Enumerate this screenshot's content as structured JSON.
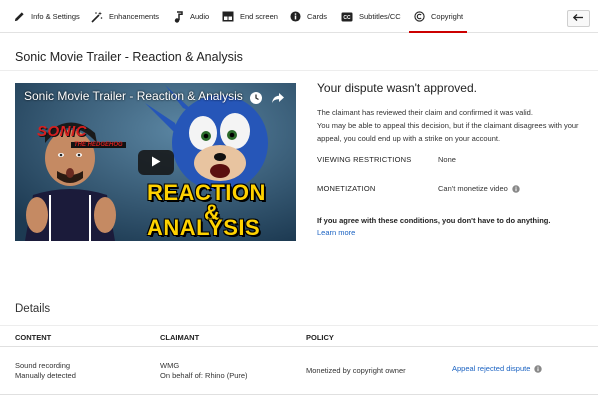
{
  "tabs": [
    {
      "label": "Info & Settings",
      "icon": "pencil-icon"
    },
    {
      "label": "Enhancements",
      "icon": "magic-wand-icon"
    },
    {
      "label": "Audio",
      "icon": "music-note-icon"
    },
    {
      "label": "End screen",
      "icon": "end-screen-icon"
    },
    {
      "label": "Cards",
      "icon": "info-circle-icon"
    },
    {
      "label": "Subtitles/CC",
      "icon": "cc-icon"
    },
    {
      "label": "Copyright",
      "icon": "copyright-icon",
      "active": true
    }
  ],
  "colors": {
    "accent": "#cc0000",
    "link": "#1a62c2"
  },
  "video": {
    "title": "Sonic Movie Trailer - Reaction & Analysis",
    "thumbnail": {
      "overlay_title": "Sonic Movie Trailer - Reaction & Analysis",
      "text_sonic": "SONIC",
      "text_hedgehog": "THE HEDGEHOG",
      "text_line1": "REACTION",
      "text_line2": "&",
      "text_line3": "ANALYSIS"
    }
  },
  "dispute": {
    "heading": "Your dispute wasn't approved.",
    "body_line1": "The claimant has reviewed their claim and confirmed it was valid.",
    "body_line2": "You may be able to appeal this decision, but if the claimant disagrees with your appeal, you could end up with a strike on your account.",
    "viewing_label": "VIEWING RESTRICTIONS",
    "viewing_value": "None",
    "monetization_label": "MONETIZATION",
    "monetization_value": "Can't monetize video",
    "agree_text": "If you agree with these conditions, you don't have to do anything.",
    "learn_more": "Learn more"
  },
  "details": {
    "title": "Details",
    "columns": {
      "content": "CONTENT",
      "claimant": "CLAIMANT",
      "policy": "POLICY"
    },
    "row": {
      "content_line1": "Sound recording",
      "content_line2": "Manually detected",
      "claimant_line1": "WMG",
      "claimant_line2": "On behalf of: Rhino (Pure)",
      "policy": "Monetized by copyright owner",
      "action": "Appeal rejected dispute"
    }
  }
}
